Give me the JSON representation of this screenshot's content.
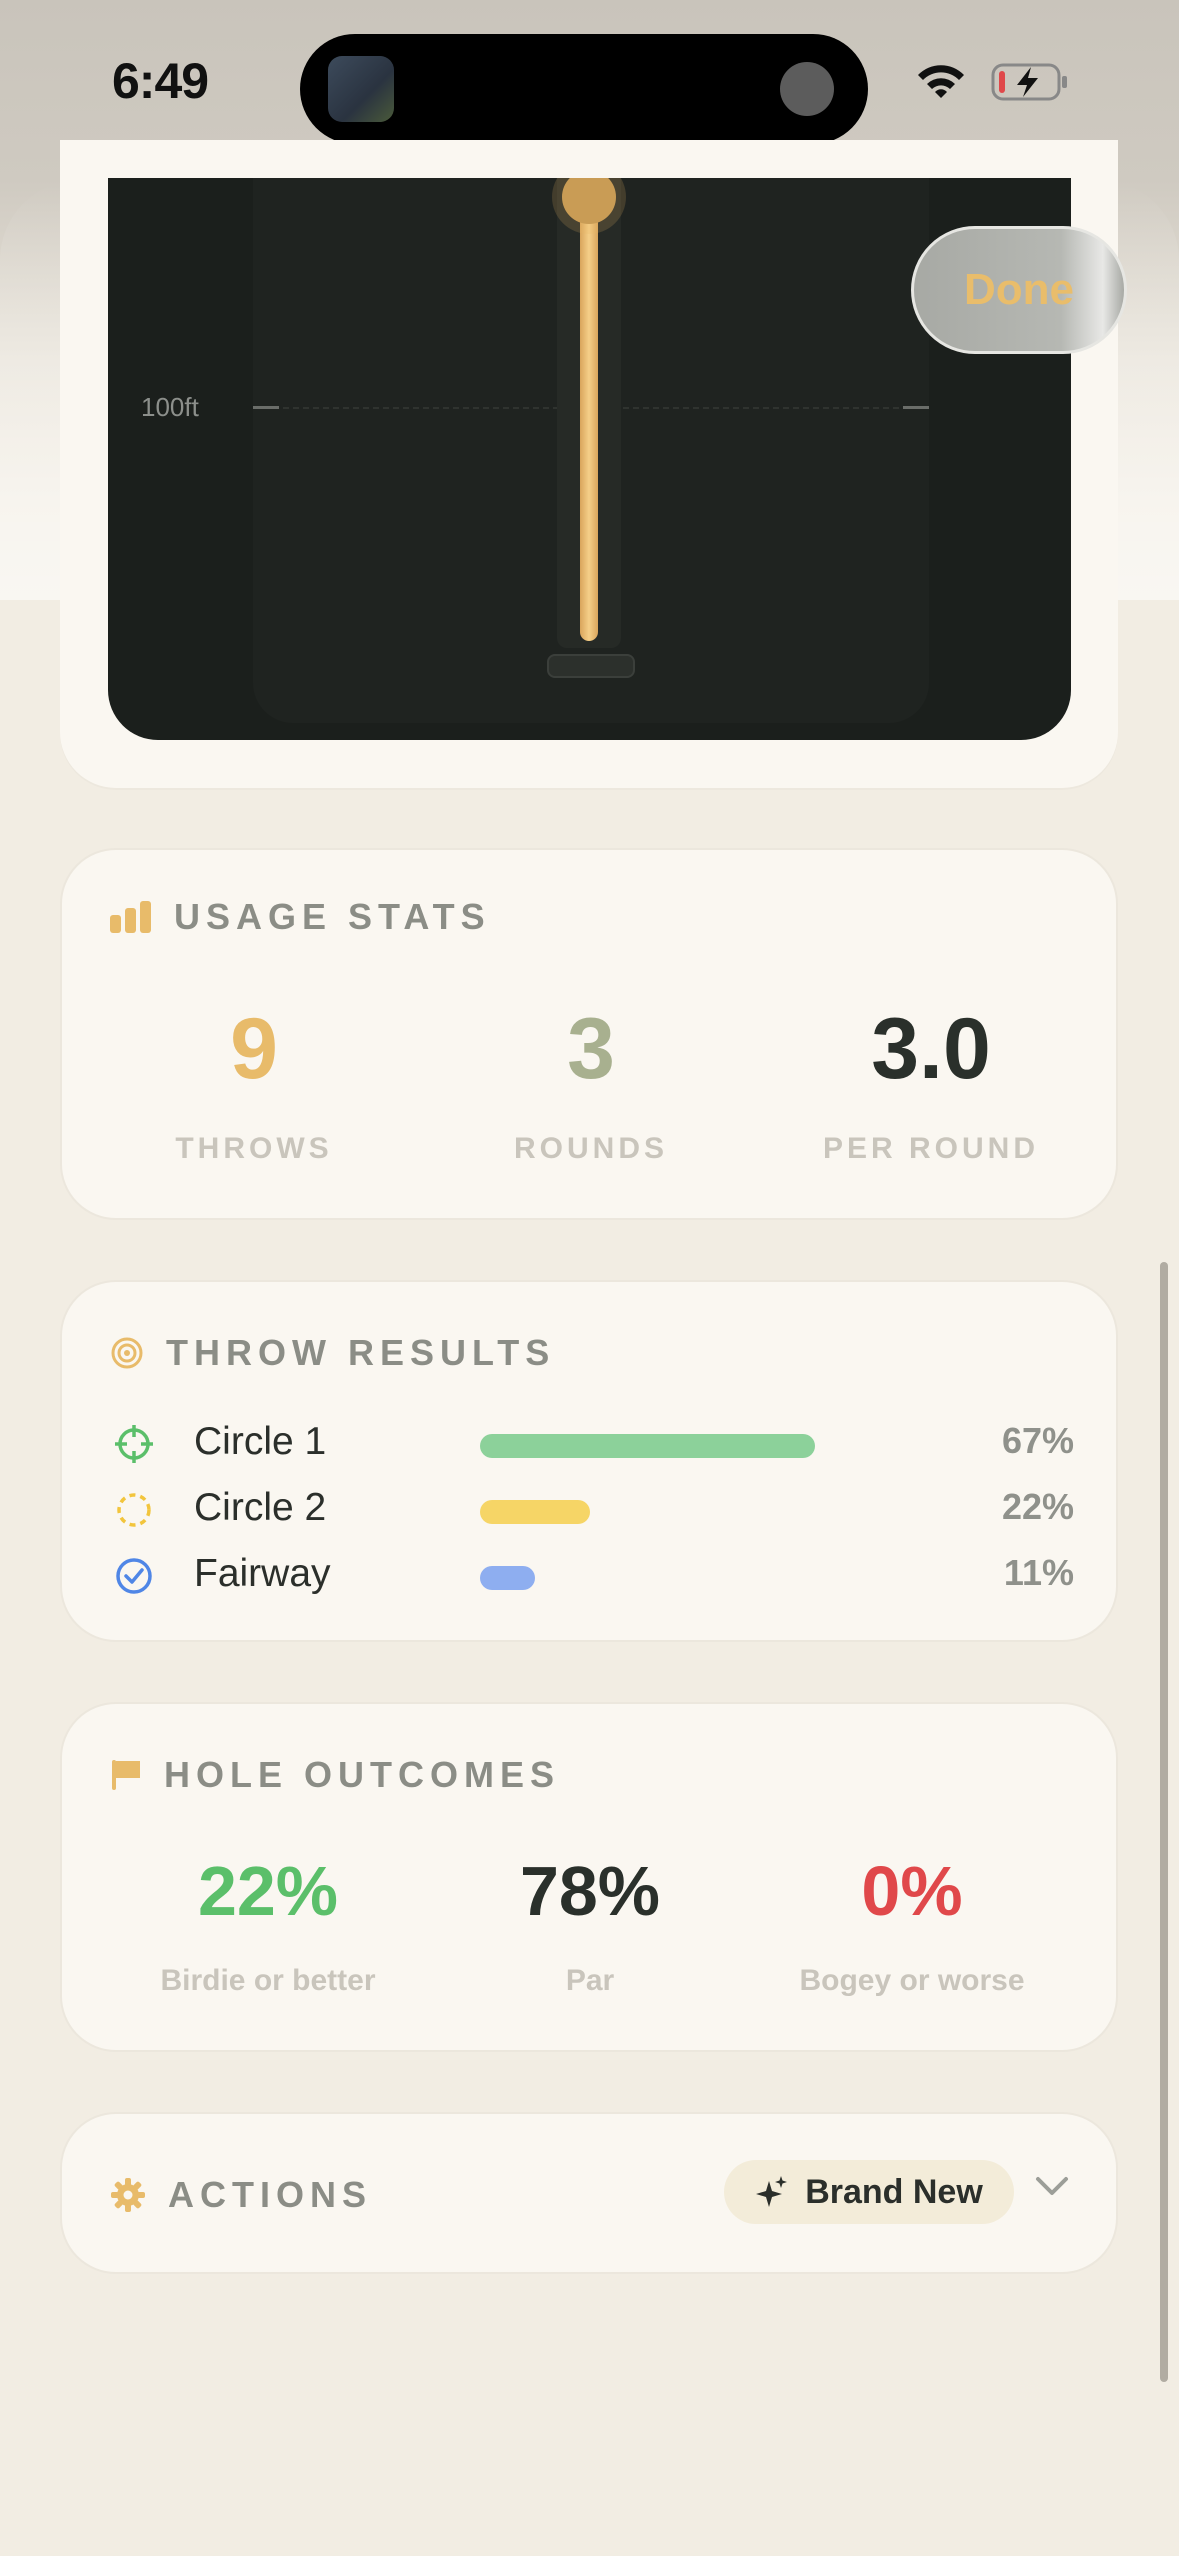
{
  "status_bar": {
    "time": "6:49"
  },
  "preview": {
    "scale_label": "100ft",
    "done_label": "Done"
  },
  "usage": {
    "title": "USAGE STATS",
    "stats": [
      {
        "value": "9",
        "label": "THROWS",
        "color": "#e8bb6a"
      },
      {
        "value": "3",
        "label": "ROUNDS",
        "color": "#a8b08f"
      },
      {
        "value": "3.0",
        "label": "PER ROUND",
        "color": "#2a302b"
      }
    ]
  },
  "throw_results": {
    "title": "THROW RESULTS",
    "rows": [
      {
        "label": "Circle 1",
        "pct": "67%",
        "fraction": 0.67,
        "color": "#8cd19a",
        "icon": "crosshair-icon"
      },
      {
        "label": "Circle 2",
        "pct": "22%",
        "fraction": 0.22,
        "color": "#f6d566",
        "icon": "dashed-circle-icon"
      },
      {
        "label": "Fairway",
        "pct": "11%",
        "fraction": 0.11,
        "color": "#8eaef0",
        "icon": "check-circle-icon"
      }
    ]
  },
  "hole_outcomes": {
    "title": "HOLE OUTCOMES",
    "items": [
      {
        "value": "22%",
        "label": "Birdie or better",
        "color": "#5bbf6a"
      },
      {
        "value": "78%",
        "label": "Par",
        "color": "#2a302b"
      },
      {
        "value": "0%",
        "label": "Bogey or worse",
        "color": "#e0484a"
      }
    ]
  },
  "actions": {
    "title": "ACTIONS",
    "badge_label": "Brand New"
  },
  "colors": {
    "accent": "#e8bb6a",
    "background": "#f2ede3",
    "card": "#faf7f1"
  }
}
